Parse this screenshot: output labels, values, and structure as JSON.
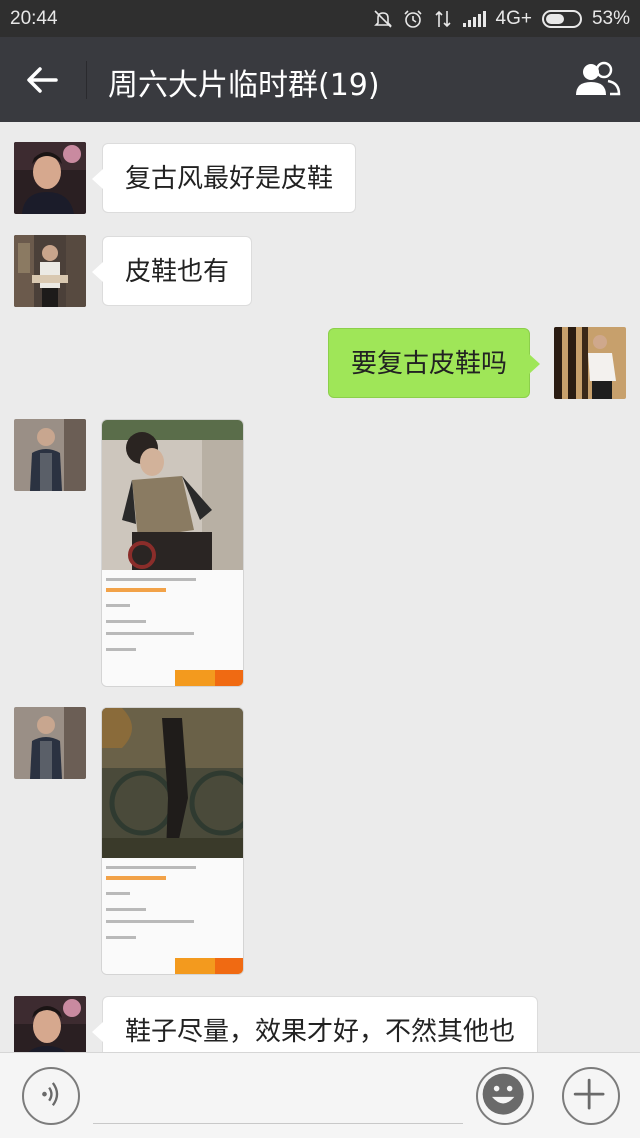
{
  "status_bar": {
    "time": "20:44",
    "network": "4G+",
    "battery": "53%",
    "icons": [
      "mute-icon",
      "alarm-icon",
      "data-transfer-icon",
      "signal-icon",
      "battery-icon"
    ]
  },
  "header": {
    "title": "周六大片临时群(19)",
    "back_icon": "back-arrow-icon",
    "members_icon": "group-members-icon",
    "bg_color": "#393a3f"
  },
  "messages": [
    {
      "side": "left",
      "type": "text",
      "text": "复古风最好是皮鞋"
    },
    {
      "side": "left",
      "type": "text",
      "text": "皮鞋也有"
    },
    {
      "side": "right",
      "type": "text",
      "text": "要复古皮鞋吗"
    },
    {
      "side": "left",
      "type": "image",
      "image": "screenshot-photo"
    },
    {
      "side": "left",
      "type": "image",
      "image": "screenshot-photo"
    },
    {
      "side": "left",
      "type": "text",
      "text": "鞋子尽量，效果才好，不然其他也"
    }
  ],
  "colors": {
    "chat_bg": "#ebebeb",
    "sent_bubble": "#9fe658",
    "received_bubble": "#ffffff"
  },
  "input_bar": {
    "voice_icon": "voice-icon",
    "emoji_icon": "emoji-icon",
    "plus_icon": "plus-icon",
    "input_value": ""
  }
}
